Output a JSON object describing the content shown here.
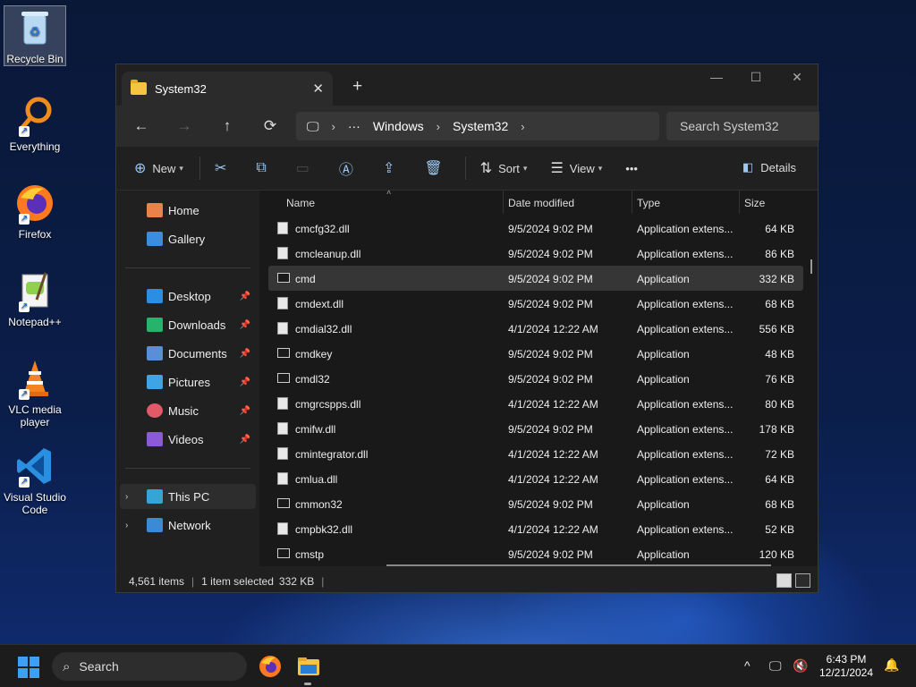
{
  "desktop": {
    "icons": [
      {
        "label": "Recycle Bin"
      },
      {
        "label": "Everything"
      },
      {
        "label": "Firefox"
      },
      {
        "label": "Notepad++"
      },
      {
        "label": "VLC media player"
      },
      {
        "label": "Visual Studio Code"
      }
    ]
  },
  "window": {
    "tab_title": "System32",
    "tab_close": "✕",
    "new_tab": "+",
    "controls": {
      "minimize": "—",
      "maximize": "☐",
      "close": "✕"
    }
  },
  "nav": {
    "back": "←",
    "forward": "→",
    "up": "↑",
    "refresh": "⟳",
    "breadcrumb": [
      "Windows",
      "System32"
    ],
    "more": "···",
    "search_placeholder": "Search System32"
  },
  "commands": {
    "new": "New",
    "sort": "Sort",
    "view": "View",
    "more": "•••",
    "details": "Details",
    "icons": {
      "cut": "✂",
      "copy": "⧉",
      "paste": "📋",
      "rename": "🅰",
      "share": "⇪",
      "delete": "🗑"
    }
  },
  "sidebar": {
    "items": [
      {
        "label": "Home",
        "color": "#e9834a"
      },
      {
        "label": "Gallery",
        "color": "#3b8de0"
      },
      {
        "label": "Desktop",
        "color": "#2a8fe3",
        "pinned": true
      },
      {
        "label": "Downloads",
        "color": "#26b36b",
        "pinned": true
      },
      {
        "label": "Documents",
        "color": "#5a8fd8",
        "pinned": true
      },
      {
        "label": "Pictures",
        "color": "#3ea4e6",
        "pinned": true
      },
      {
        "label": "Music",
        "color": "#e05a6a",
        "pinned": true
      },
      {
        "label": "Videos",
        "color": "#8a5ad8",
        "pinned": true
      },
      {
        "label": "This PC",
        "color": "#35a5d6"
      },
      {
        "label": "Network",
        "color": "#3a8ad6"
      }
    ],
    "pin_glyph": "📌",
    "chevron": "›"
  },
  "columns": {
    "name": "Name",
    "date": "Date modified",
    "type": "Type",
    "size": "Size"
  },
  "files": [
    {
      "name": "cmcfg32.dll",
      "date": "9/5/2024 9:02 PM",
      "type": "Application extens...",
      "size": "64 KB"
    },
    {
      "name": "cmcleanup.dll",
      "date": "9/5/2024 9:02 PM",
      "type": "Application extens...",
      "size": "86 KB"
    },
    {
      "name": "cmd",
      "date": "9/5/2024 9:02 PM",
      "type": "Application",
      "size": "332 KB"
    },
    {
      "name": "cmdext.dll",
      "date": "9/5/2024 9:02 PM",
      "type": "Application extens...",
      "size": "68 KB"
    },
    {
      "name": "cmdial32.dll",
      "date": "4/1/2024 12:22 AM",
      "type": "Application extens...",
      "size": "556 KB"
    },
    {
      "name": "cmdkey",
      "date": "9/5/2024 9:02 PM",
      "type": "Application",
      "size": "48 KB"
    },
    {
      "name": "cmdl32",
      "date": "9/5/2024 9:02 PM",
      "type": "Application",
      "size": "76 KB"
    },
    {
      "name": "cmgrcspps.dll",
      "date": "4/1/2024 12:22 AM",
      "type": "Application extens...",
      "size": "80 KB"
    },
    {
      "name": "cmifw.dll",
      "date": "9/5/2024 9:02 PM",
      "type": "Application extens...",
      "size": "178 KB"
    },
    {
      "name": "cmintegrator.dll",
      "date": "4/1/2024 12:22 AM",
      "type": "Application extens...",
      "size": "72 KB"
    },
    {
      "name": "cmlua.dll",
      "date": "4/1/2024 12:22 AM",
      "type": "Application extens...",
      "size": "64 KB"
    },
    {
      "name": "cmmon32",
      "date": "9/5/2024 9:02 PM",
      "type": "Application",
      "size": "68 KB"
    },
    {
      "name": "cmpbk32.dll",
      "date": "4/1/2024 12:22 AM",
      "type": "Application extens...",
      "size": "52 KB"
    },
    {
      "name": "cmstp",
      "date": "9/5/2024 9:02 PM",
      "type": "Application",
      "size": "120 KB"
    }
  ],
  "status": {
    "items": "4,561 items",
    "selected": "1 item selected",
    "size": "332 KB",
    "bar": "|"
  },
  "taskbar": {
    "search": "Search",
    "time": "6:43 PM",
    "date": "12/21/2024",
    "chevron": "^",
    "bell": "🔔"
  }
}
